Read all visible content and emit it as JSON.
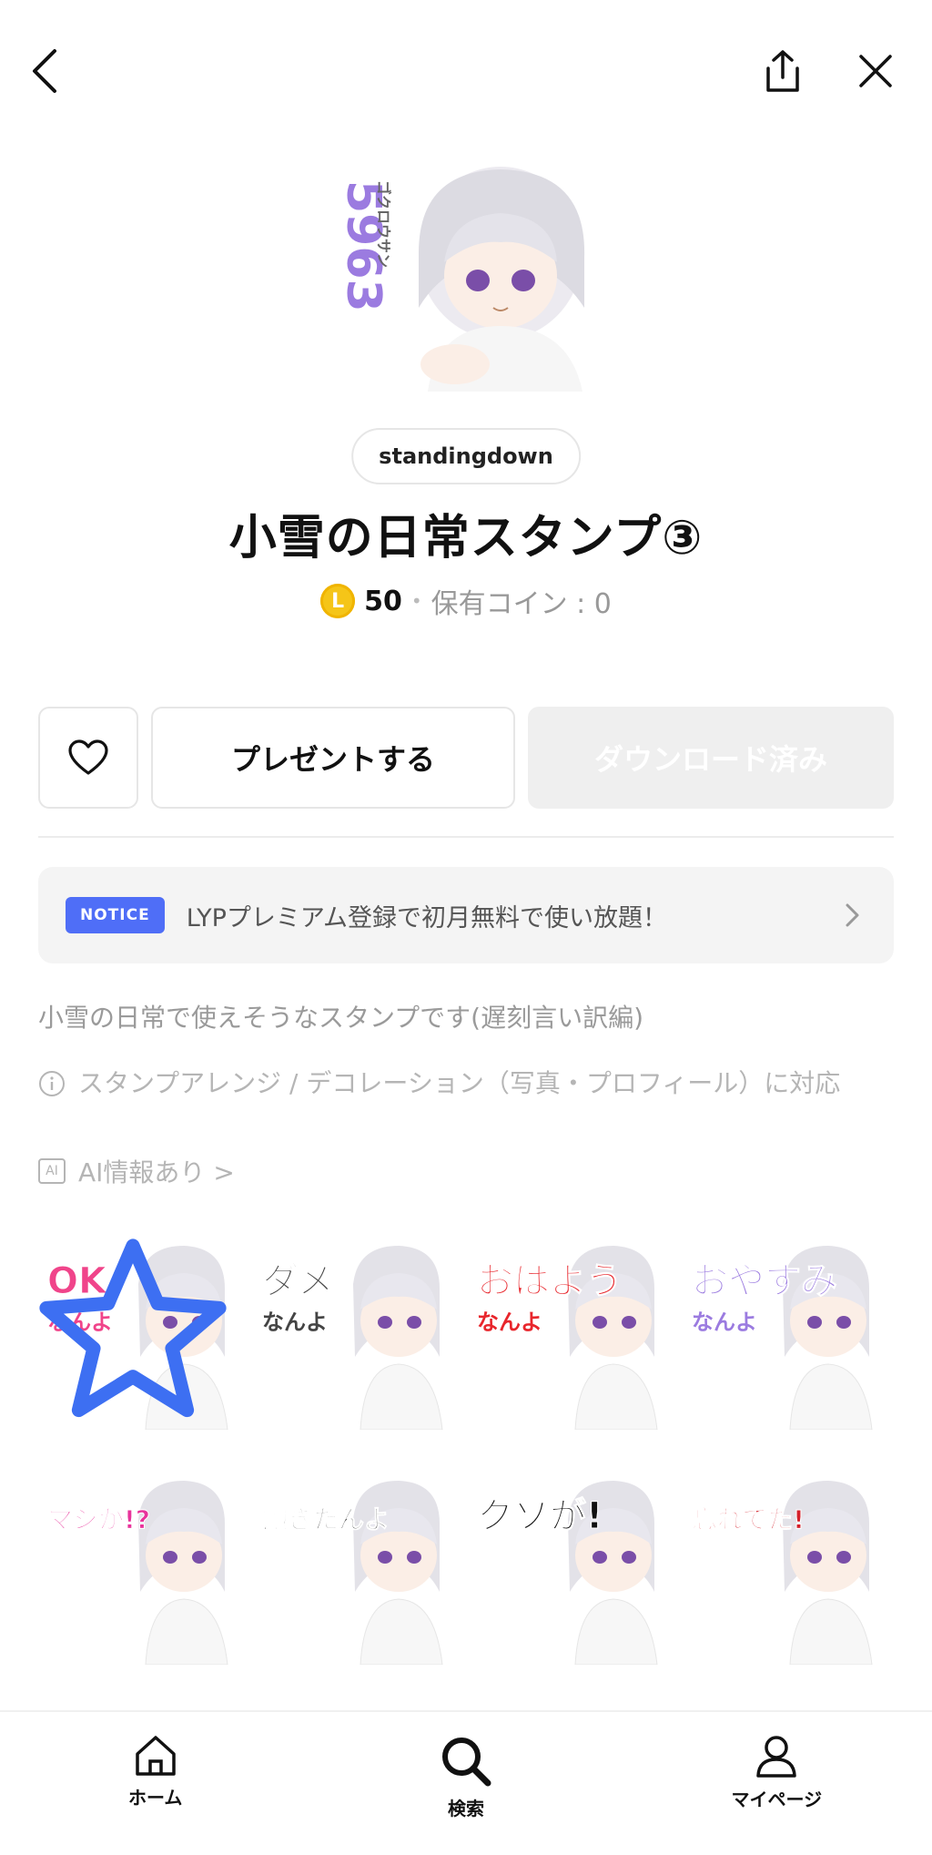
{
  "header": {
    "back": "back-icon",
    "share": "share-icon",
    "close": "close-icon"
  },
  "hero": {
    "badge_text": "5963",
    "badge_sub": "ゴクロウサン"
  },
  "author": "standingdown",
  "title": "小雪の日常スタンプ③",
  "price": {
    "coin_symbol": "L",
    "value": "50",
    "separator": "•",
    "owned": "保有コイン : 0"
  },
  "actions": {
    "present": "プレゼントする",
    "download": "ダウンロード済み"
  },
  "notice": {
    "badge": "NOTICE",
    "text": "LYPプレミアム登録で初月無料で使い放題！"
  },
  "description": "小雪の日常で使えそうなスタンプです(遅刻言い訳編)",
  "feature_note": "スタンプアレンジ / デコレーション（写真・プロフィール）に対応",
  "ai_badge": "AI",
  "ai_info": "AI情報あり >",
  "stickers": [
    {
      "line1": "OK",
      "line2": "なんよ",
      "color": "#f0448a"
    },
    {
      "line1": "ダメ",
      "line2": "なんよ",
      "color": "#444444"
    },
    {
      "line1": "おはよう",
      "line2": "なんよ",
      "color": "#e8262c"
    },
    {
      "line1": "おやすみ",
      "line2": "なんよ",
      "color": "#9b7be0"
    },
    {
      "line1": "マジか!?",
      "line2": "",
      "color": "#e8339b"
    },
    {
      "line1": "飽きたんよ",
      "line2": "",
      "color": "#444444"
    },
    {
      "line1": "クソが!",
      "line2": "",
      "color": "#111111"
    },
    {
      "line1": "忘れてた!",
      "line2": "",
      "color": "#d4202a"
    }
  ],
  "tabs": [
    {
      "label": "ホーム",
      "icon": "home-icon"
    },
    {
      "label": "検索",
      "icon": "search-icon"
    },
    {
      "label": "マイページ",
      "icon": "profile-icon"
    }
  ],
  "colors": {
    "notice_badge": "#4f6ef7",
    "coin": "#f5c518",
    "hero_badge": "#9b7be0"
  }
}
